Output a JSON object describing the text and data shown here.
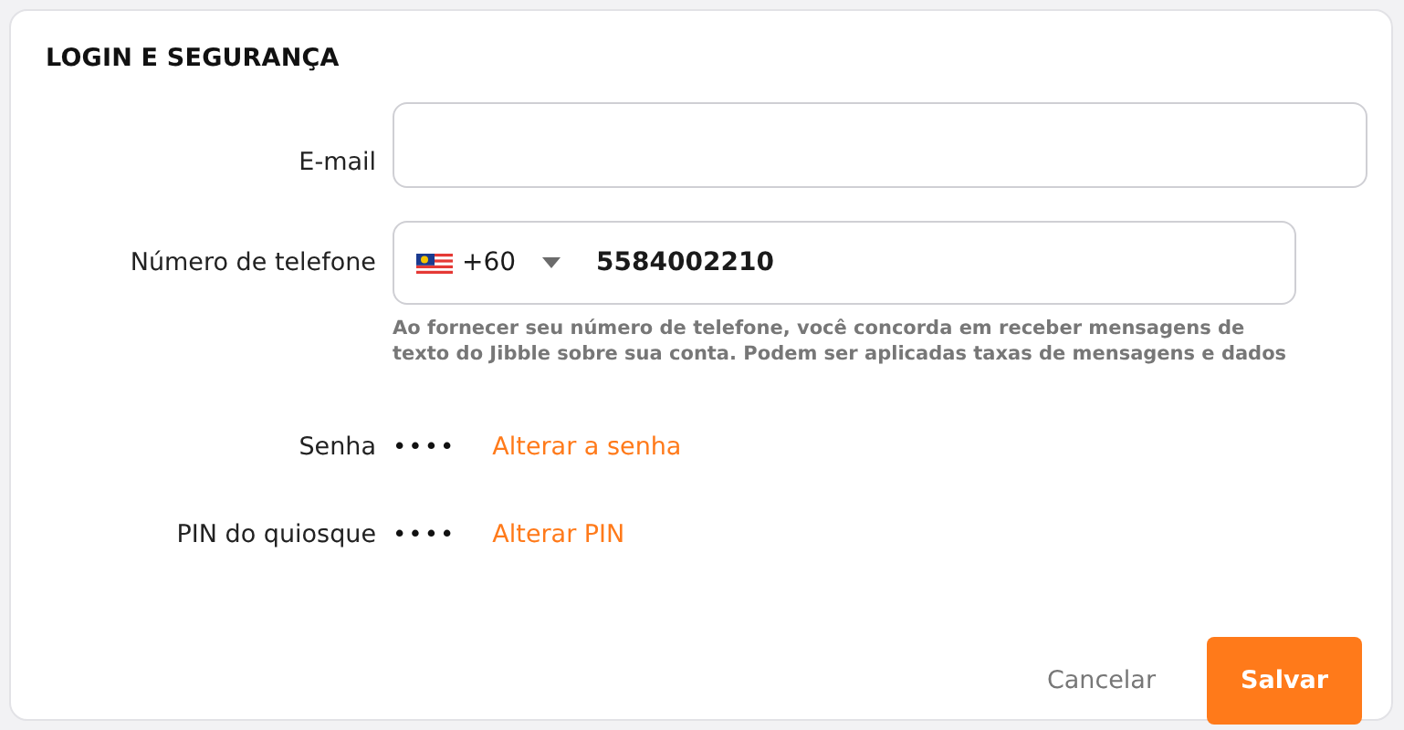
{
  "section_title": "LOGIN E SEGURANÇA",
  "email": {
    "label": "E-mail"
  },
  "phone": {
    "label": "Número de telefone",
    "country_code": "+60",
    "value": "5584002210",
    "hint": "Ao fornecer seu número de telefone, você concorda em receber mensagens de texto do Jibble sobre sua conta. Podem ser aplicadas taxas de mensagens e dados"
  },
  "secrets": [
    {
      "label": "Senha",
      "masked": "••••",
      "link": "Alterar a senha"
    },
    {
      "label": "PIN do quiosque",
      "masked": "••••",
      "link": "Alterar PIN"
    }
  ],
  "buttons": [
    {
      "label": "Cancelar",
      "kind": "text"
    },
    {
      "label": "Salvar",
      "kind": "primary"
    }
  ]
}
